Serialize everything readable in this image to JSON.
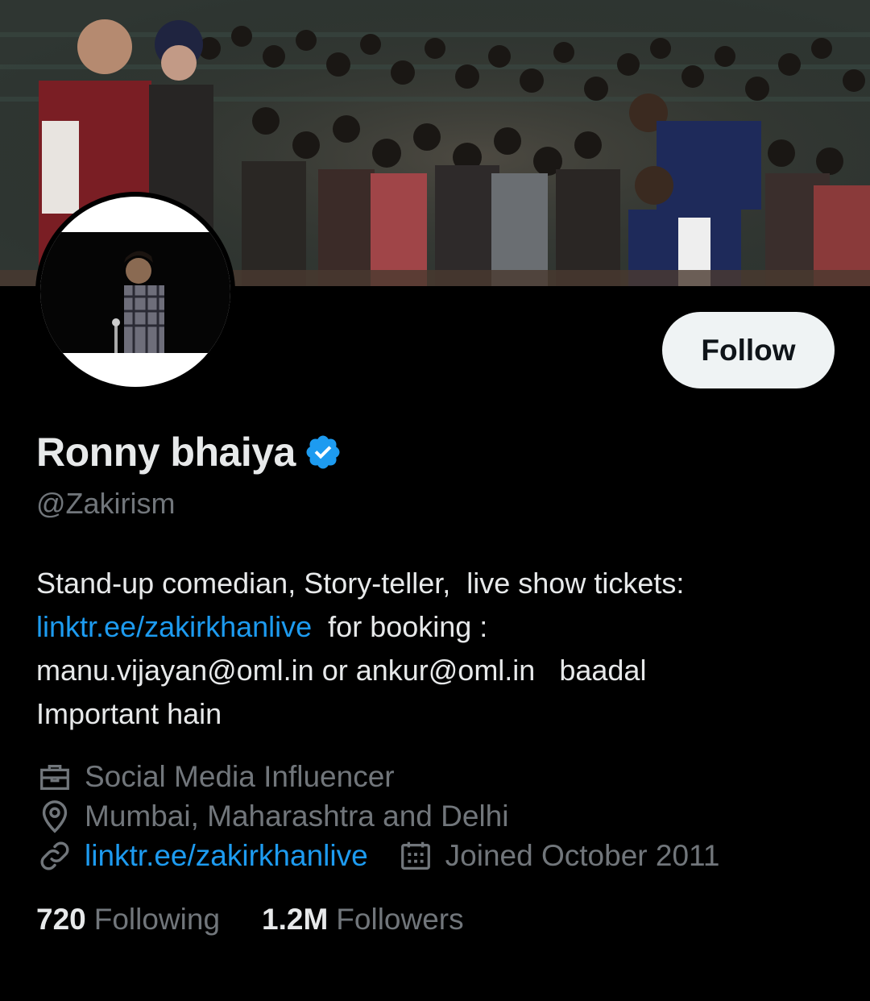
{
  "profile": {
    "display_name": "Ronny bhaiya",
    "handle": "@Zakirism",
    "verified": true,
    "follow_label": "Follow"
  },
  "bio": {
    "line1": "Stand-up comedian, Story-teller,  live show tickets:",
    "line2_link": "linktr.ee/zakirkhanlive",
    "line2_rest": "  for booking :",
    "line3": "manu.vijayan@oml.in or ankur@oml.in   baadal",
    "line4": "Important hain"
  },
  "meta": {
    "profession": "Social Media Influencer",
    "location": "Mumbai, Maharashtra and Delhi",
    "website": "linktr.ee/zakirkhanlive",
    "joined": "Joined October 2011"
  },
  "stats": {
    "following_count": "720",
    "following_label": "Following",
    "followers_count": "1.2M",
    "followers_label": "Followers"
  },
  "icons": {
    "profession": "briefcase-icon",
    "location": "location-pin-icon",
    "website": "link-icon",
    "joined": "calendar-icon",
    "verified": "verified-badge-icon"
  },
  "colors": {
    "background": "#000000",
    "text_primary": "#e7e9ea",
    "text_secondary": "#71767b",
    "link": "#1d9bf0",
    "follow_button_bg": "#eff3f4",
    "follow_button_text": "#0f1419"
  }
}
